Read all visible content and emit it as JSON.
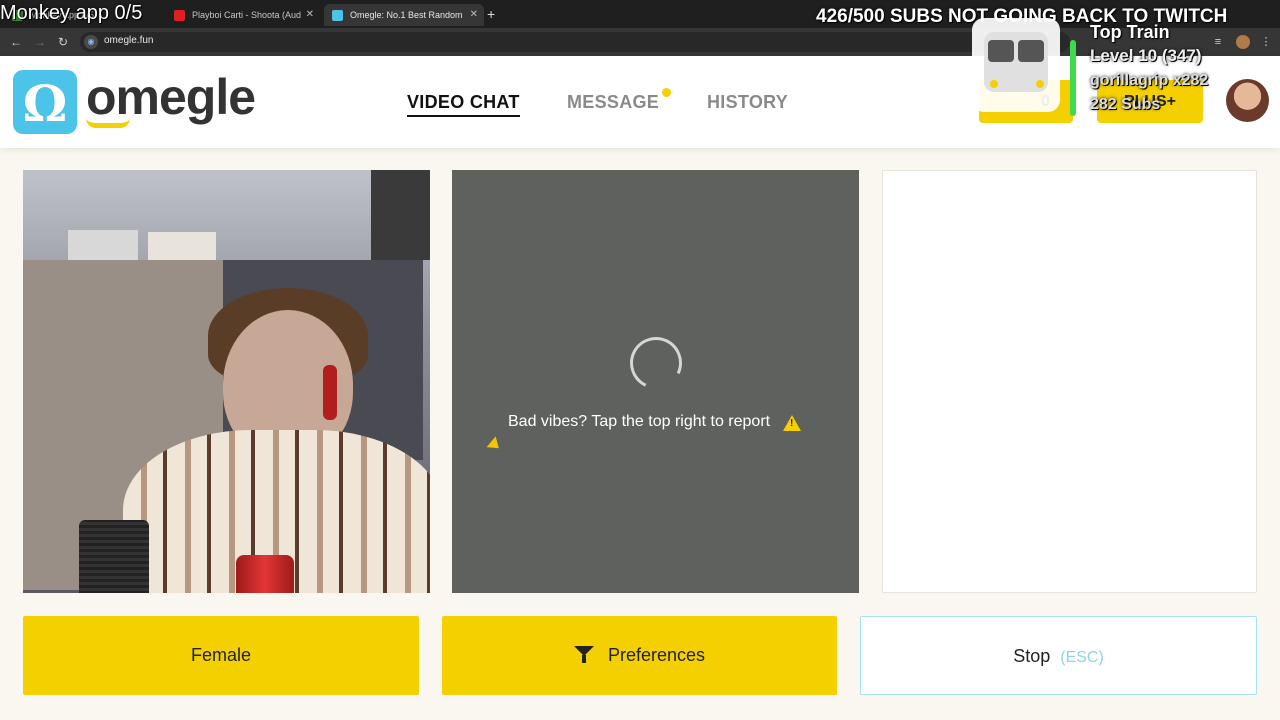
{
  "browser": {
    "tabs": [
      {
        "label": "Monkey app 0/5",
        "active": false
      },
      {
        "label": "Playboi Carti - Shoota (Aud",
        "active": false
      },
      {
        "label": "Omegle: No.1 Best Random",
        "active": true
      }
    ],
    "new_tab": "+",
    "url": "omegle.fun"
  },
  "site": {
    "logo_text": "omegle",
    "logo_symbol": "Ω",
    "nav": [
      {
        "label": "VIDEO CHAT",
        "active": true
      },
      {
        "label": "MESSAGE",
        "active": false,
        "has_dot": true
      },
      {
        "label": "HISTORY",
        "active": false
      }
    ],
    "header_buttons": [
      {
        "label": "0"
      },
      {
        "label": "PLUS+"
      }
    ]
  },
  "remote": {
    "status_text": "Bad vibes? Tap the top right to report",
    "warning_symbol": "!"
  },
  "actions": {
    "gender_label": "Female",
    "preferences_label": "Preferences",
    "stop_label": "Stop",
    "stop_shortcut": "(ESC)"
  },
  "stream_overlay": {
    "left_text": "Monkey app 0/5",
    "right_text": "426/500 SUBS NOT GOING BACK TO TWITCH",
    "train_title": "Top Train",
    "train_level": "Level 10 (347)",
    "train_user": "gorillagrip x282",
    "train_subs": "282 Subs"
  },
  "colors": {
    "brand_yellow": "#f5d000",
    "brand_blue": "#4cc3e8",
    "panel_gray": "#5f615e",
    "esc_blue": "#8fd3e8"
  }
}
